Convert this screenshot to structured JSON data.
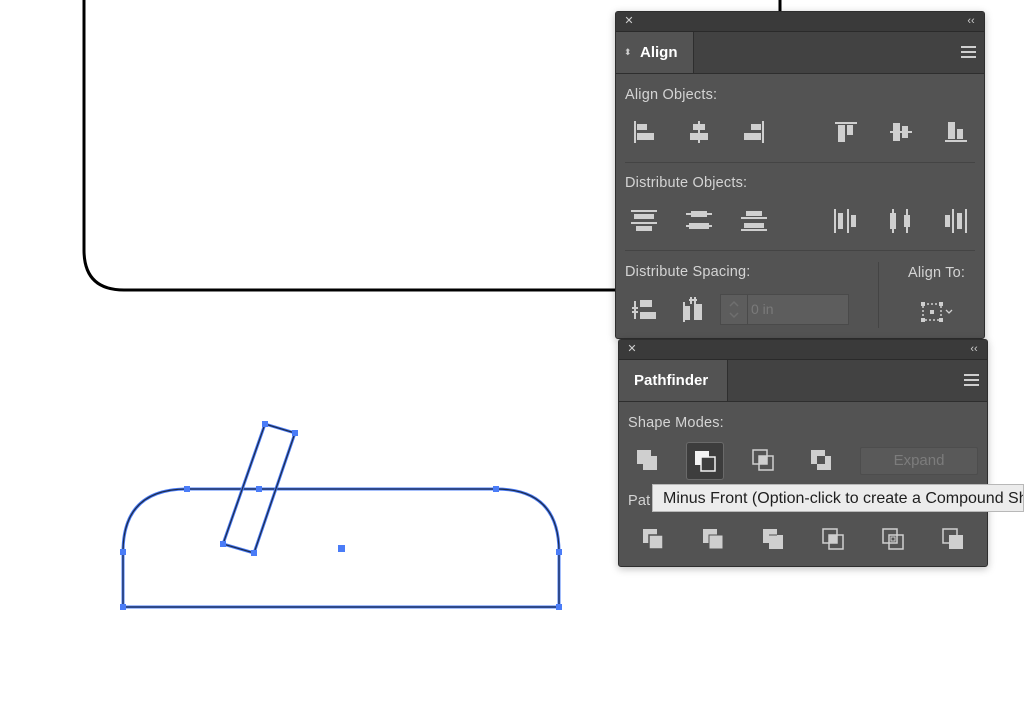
{
  "align_panel": {
    "tab_label": "Align",
    "align_objects_label": "Align Objects:",
    "distribute_objects_label": "Distribute Objects:",
    "distribute_spacing_label": "Distribute Spacing:",
    "align_to_label": "Align To:",
    "spacing_value_placeholder": "0 in",
    "align_objects_buttons": [
      "horizontal-align-left-icon",
      "horizontal-align-center-icon",
      "horizontal-align-right-icon",
      "vertical-align-top-icon",
      "vertical-align-center-icon",
      "vertical-align-bottom-icon"
    ],
    "distribute_objects_buttons": [
      "vertical-distribute-top-icon",
      "vertical-distribute-center-icon",
      "vertical-distribute-bottom-icon",
      "horizontal-distribute-left-icon",
      "horizontal-distribute-center-icon",
      "horizontal-distribute-right-icon"
    ]
  },
  "pathfinder_panel": {
    "tab_label": "Pathfinder",
    "shape_modes_label": "Shape Modes:",
    "pathfinders_label_visible": "Pat",
    "expand_label": "Expand",
    "shape_mode_buttons": [
      "unite-icon",
      "minus-front-icon",
      "intersect-icon",
      "exclude-icon"
    ],
    "pathfinder_buttons": [
      "divide-icon",
      "trim-icon",
      "merge-icon",
      "crop-icon",
      "outline-icon",
      "minus-back-icon"
    ]
  },
  "tooltip": {
    "text": "Minus Front (Option-click to create a Compound Shape)"
  },
  "colors": {
    "panel_bg": "#535353",
    "selection_blue": "#4a7cf7",
    "path_dark": "#1d2b4a"
  }
}
